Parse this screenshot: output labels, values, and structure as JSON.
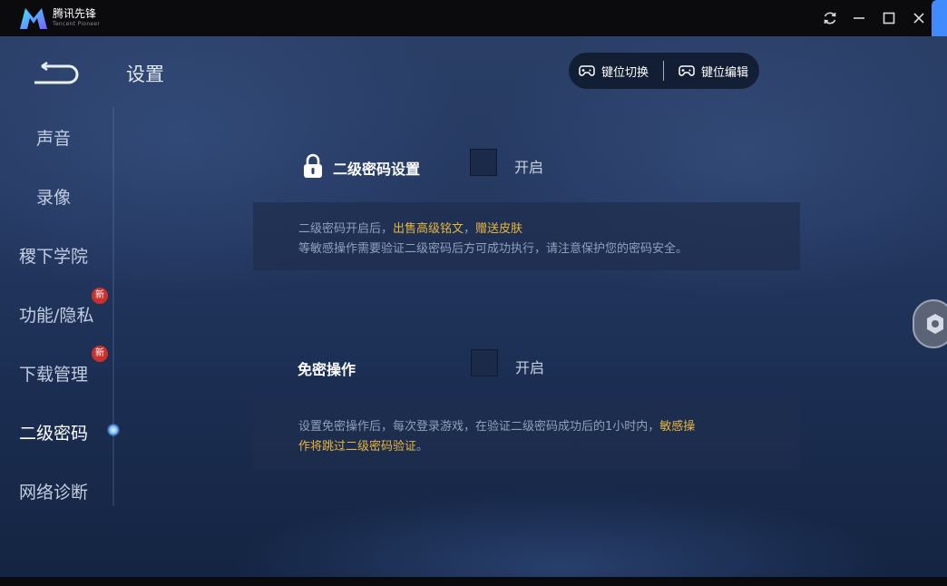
{
  "titlebar": {
    "app_name": "腾讯先锋",
    "app_subtitle": "Tencent Pioneer",
    "icons": [
      "logo-icon",
      "refresh-icon",
      "minimize-icon",
      "maximize-icon",
      "close-icon"
    ]
  },
  "header": {
    "title": "设置",
    "keymap_switch": "键位切换",
    "keymap_edit": "键位编辑"
  },
  "sidebar": {
    "items": [
      {
        "label": "声音"
      },
      {
        "label": "录像"
      },
      {
        "label": "稷下学院"
      },
      {
        "label": "功能/隐私",
        "badge": "新"
      },
      {
        "label": "下载管理",
        "badge": "新"
      },
      {
        "label": "二级密码",
        "active": true
      },
      {
        "label": "网络诊断"
      }
    ]
  },
  "sections": {
    "password": {
      "title": "二级密码设置",
      "toggle_label": "开启",
      "line1_prefix": "二级密码开启后，",
      "line1_hl1": "出售高级铭文",
      "line1_sep": "，",
      "line1_hl2": "赠送皮肤",
      "line2": "等敏感操作需要验证二级密码后方可成功执行，请注意保护您的密码安全。"
    },
    "nopass": {
      "title": "免密操作",
      "toggle_label": "开启",
      "line1_prefix": "设置免密操作后，每次登录游戏，在验证二级密码成功后的1小时内，",
      "line1_hl": "敏感操",
      "line2_hl": "作将跳过二级密码验证",
      "line2_suffix": "。"
    }
  },
  "colors": {
    "highlight": "#e8b63c",
    "accent_blue": "#3f8bff",
    "badge_red": "#c9322c"
  }
}
